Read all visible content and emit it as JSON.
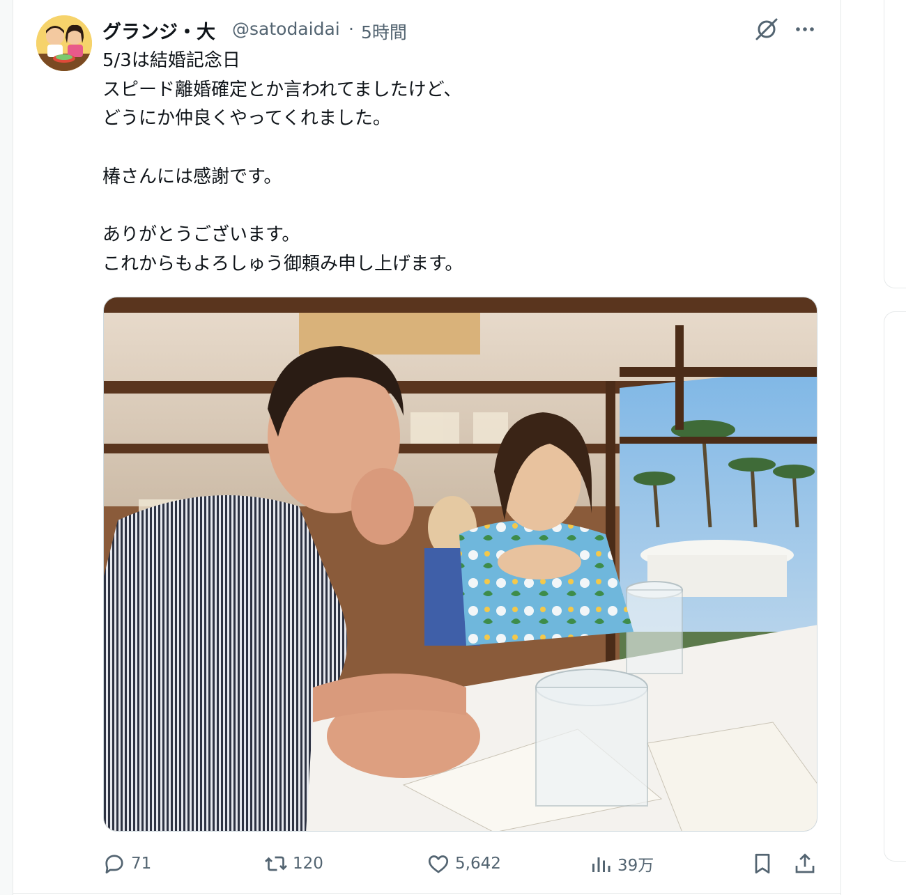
{
  "tweet": {
    "author_name": "グランジ・大",
    "handle": "@satodaidai",
    "separator": "·",
    "time": "5時間",
    "lines": [
      "5/3は結婚記念日",
      "スピード離婚確定とか言われてましたけど、",
      "どうにか仲良くやってくれました。",
      "",
      "椿さんには感謝です。",
      "",
      "ありがとうございます。",
      "これからもよろしゅう御頼み申し上げます。"
    ]
  },
  "actions": {
    "replies": "71",
    "reposts": "120",
    "likes": "5,642",
    "views": "39万"
  },
  "icons": {
    "grok": "grok-icon",
    "more": "more-icon",
    "reply": "reply-icon",
    "repost": "repost-icon",
    "like": "heart-icon",
    "views": "views-icon",
    "bookmark": "bookmark-icon",
    "share": "share-icon"
  },
  "colors": {
    "text": "#0f1419",
    "secondary": "#536471",
    "border": "#e6e9ea"
  }
}
